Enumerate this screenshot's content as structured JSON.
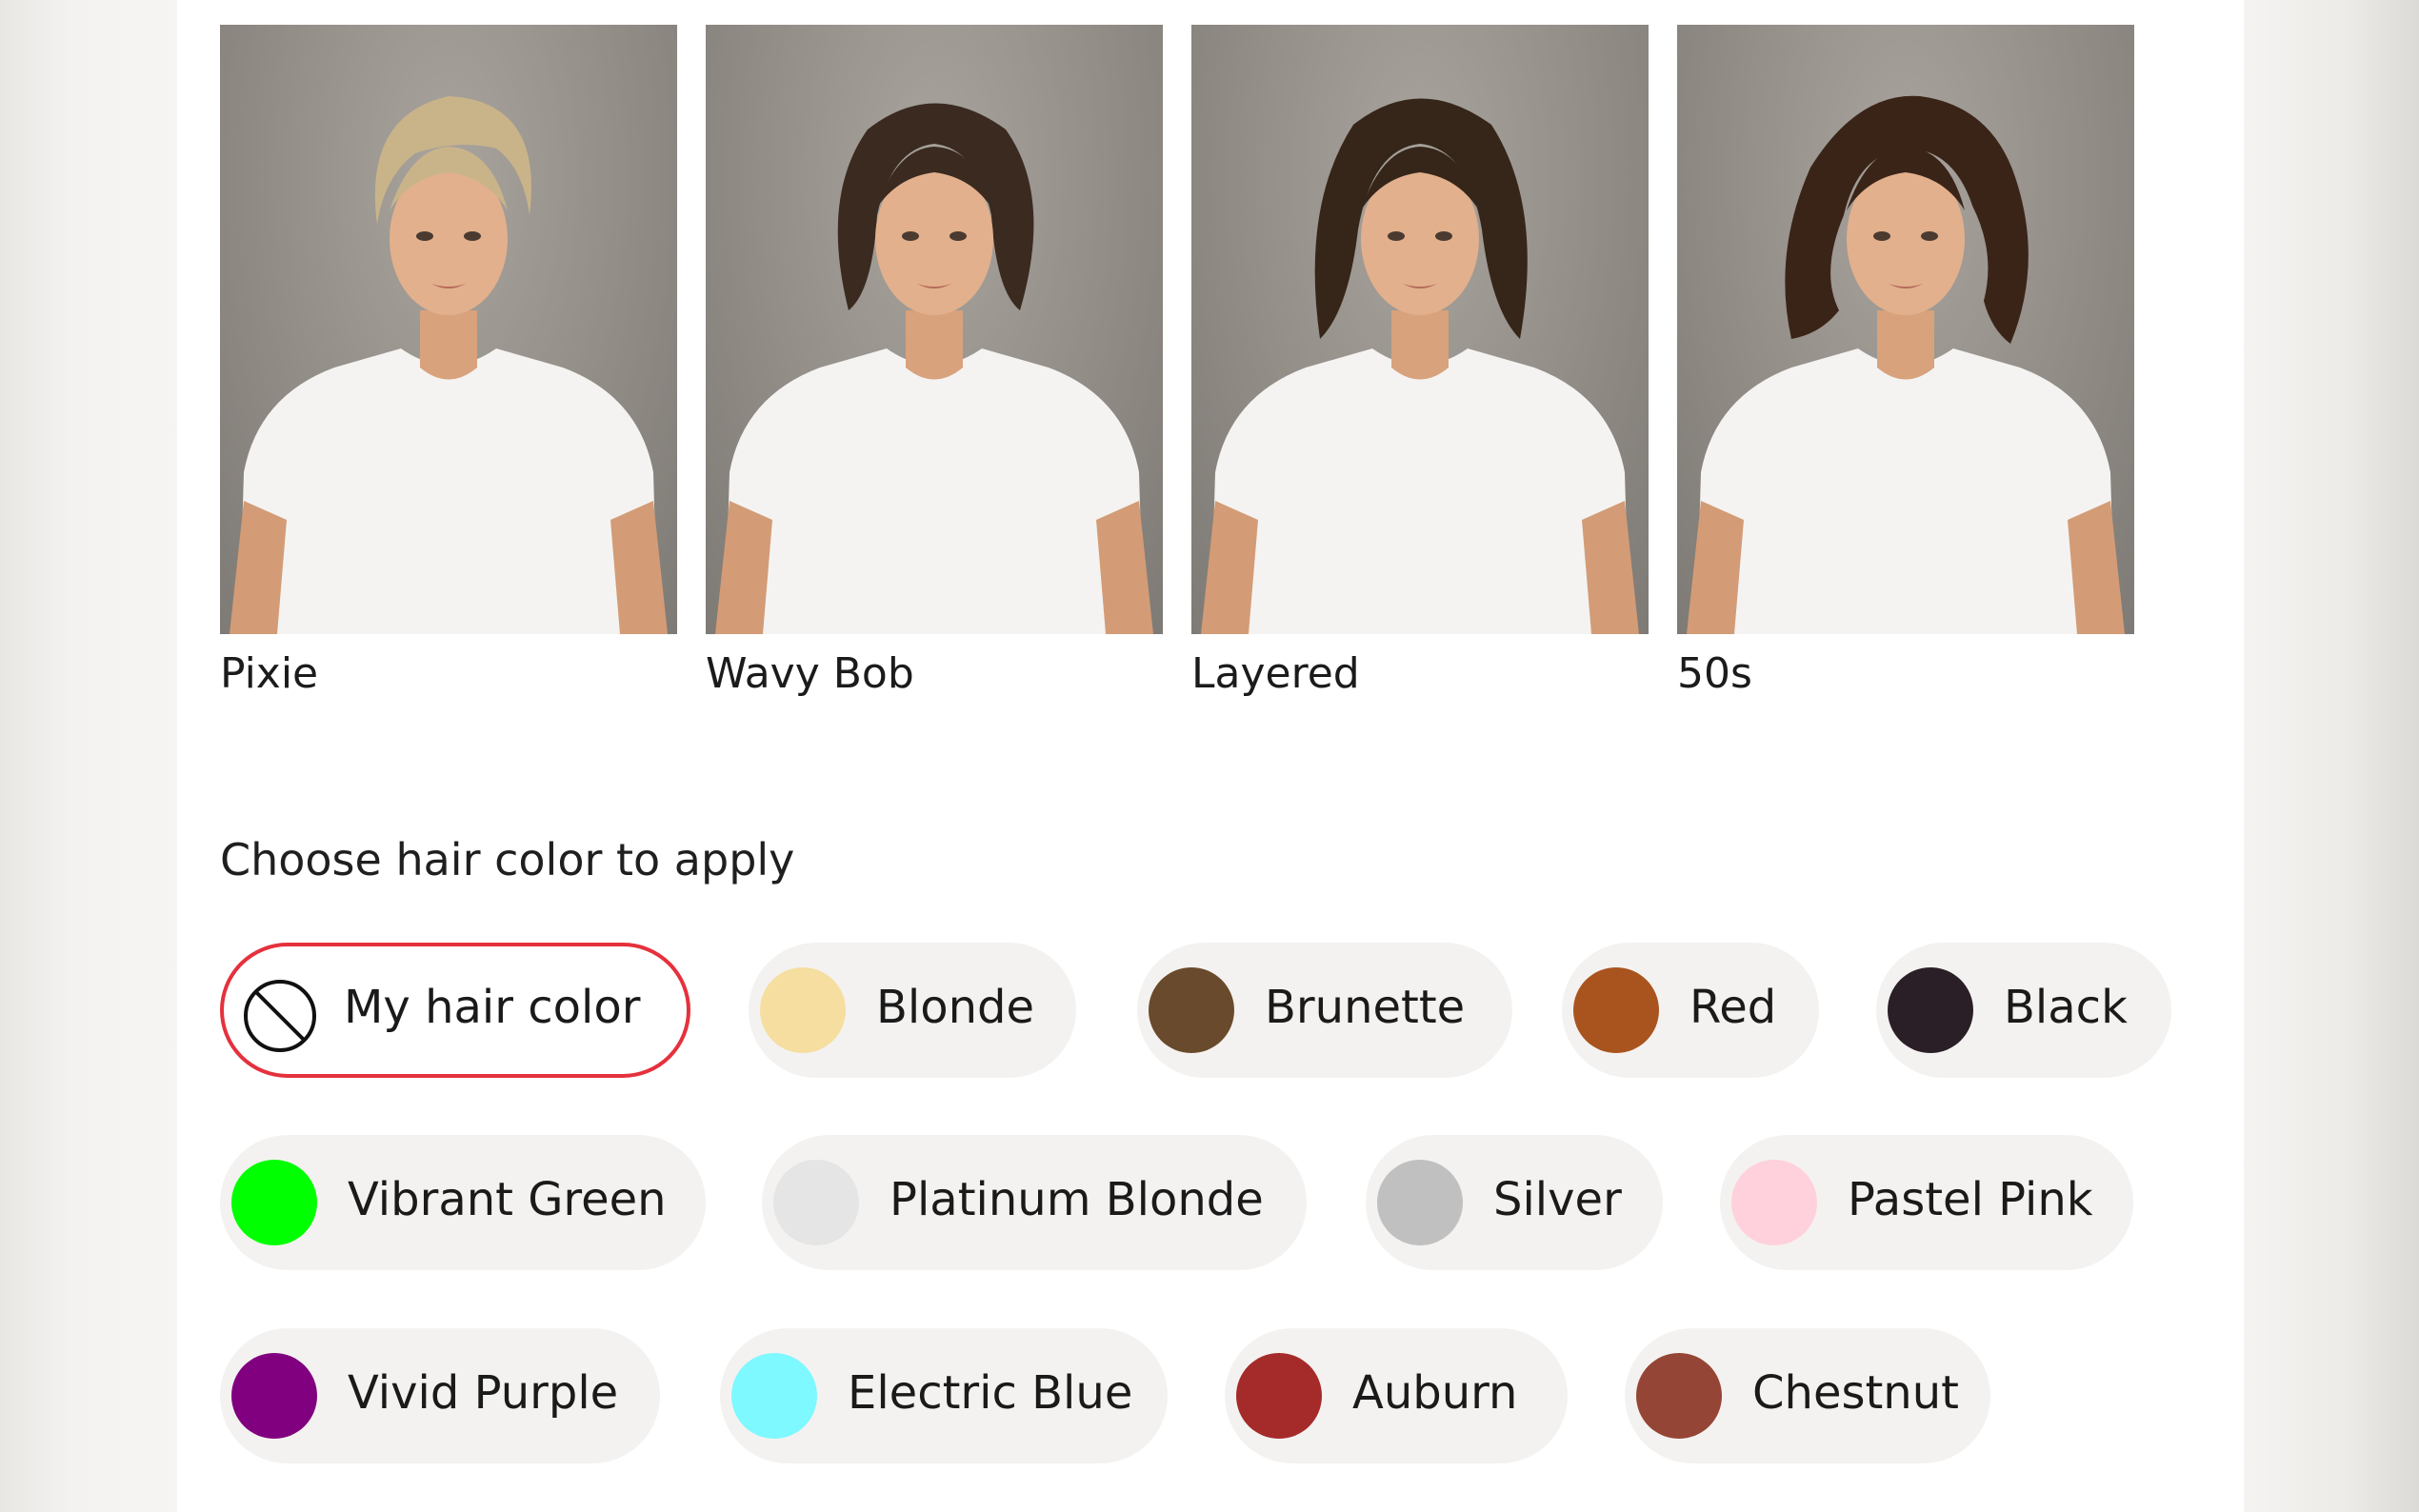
{
  "hairstyles": [
    {
      "label": "Pixie",
      "hair_color": "#c9b48a",
      "hair_shape": "pixie"
    },
    {
      "label": "Wavy Bob",
      "hair_color": "#3a2a20",
      "hair_shape": "bob"
    },
    {
      "label": "Layered",
      "hair_color": "#352619",
      "hair_shape": "layered"
    },
    {
      "label": "50s",
      "hair_color": "#3a2418",
      "hair_shape": "fifties"
    }
  ],
  "color_section": {
    "title": "Choose hair color to apply",
    "selected_index": 0,
    "options": [
      {
        "label": "My hair color",
        "swatch": "none",
        "icon": "no-color-icon"
      },
      {
        "label": "Blonde",
        "swatch": "#f5dea0"
      },
      {
        "label": "Brunette",
        "swatch": "#6a4a2c"
      },
      {
        "label": "Red",
        "swatch": "#a9541f"
      },
      {
        "label": "Black",
        "swatch": "#2a1f27"
      },
      {
        "label": "Vibrant Green",
        "swatch": "#00ff00"
      },
      {
        "label": "Platinum Blonde",
        "swatch": "#e5e5e5"
      },
      {
        "label": "Silver",
        "swatch": "#c0c0c0"
      },
      {
        "label": "Pastel Pink",
        "swatch": "#ffd1dc"
      },
      {
        "label": "Vivid Purple",
        "swatch": "#800080"
      },
      {
        "label": "Electric Blue",
        "swatch": "#7df9ff"
      },
      {
        "label": "Auburn",
        "swatch": "#a52a2a"
      },
      {
        "label": "Chestnut",
        "swatch": "#954535"
      }
    ]
  }
}
